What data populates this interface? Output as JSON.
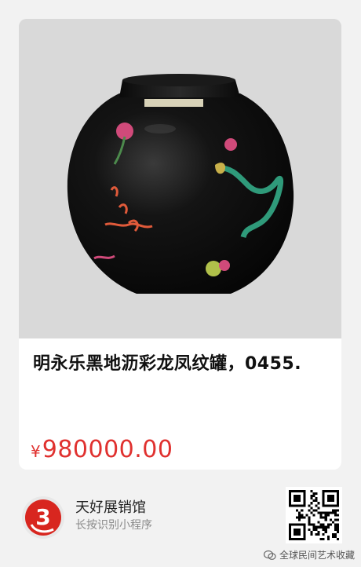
{
  "product": {
    "title": "明永乐黑地沥彩龙凤纹罐，0455.",
    "currency_symbol": "¥",
    "price": "980000.00",
    "price_color": "#e0312f"
  },
  "footer": {
    "shop_name": "天好展销馆",
    "hint": "长按识别小程序",
    "logo_number": "3"
  },
  "watermark": {
    "text": "全球民间艺术收藏"
  }
}
